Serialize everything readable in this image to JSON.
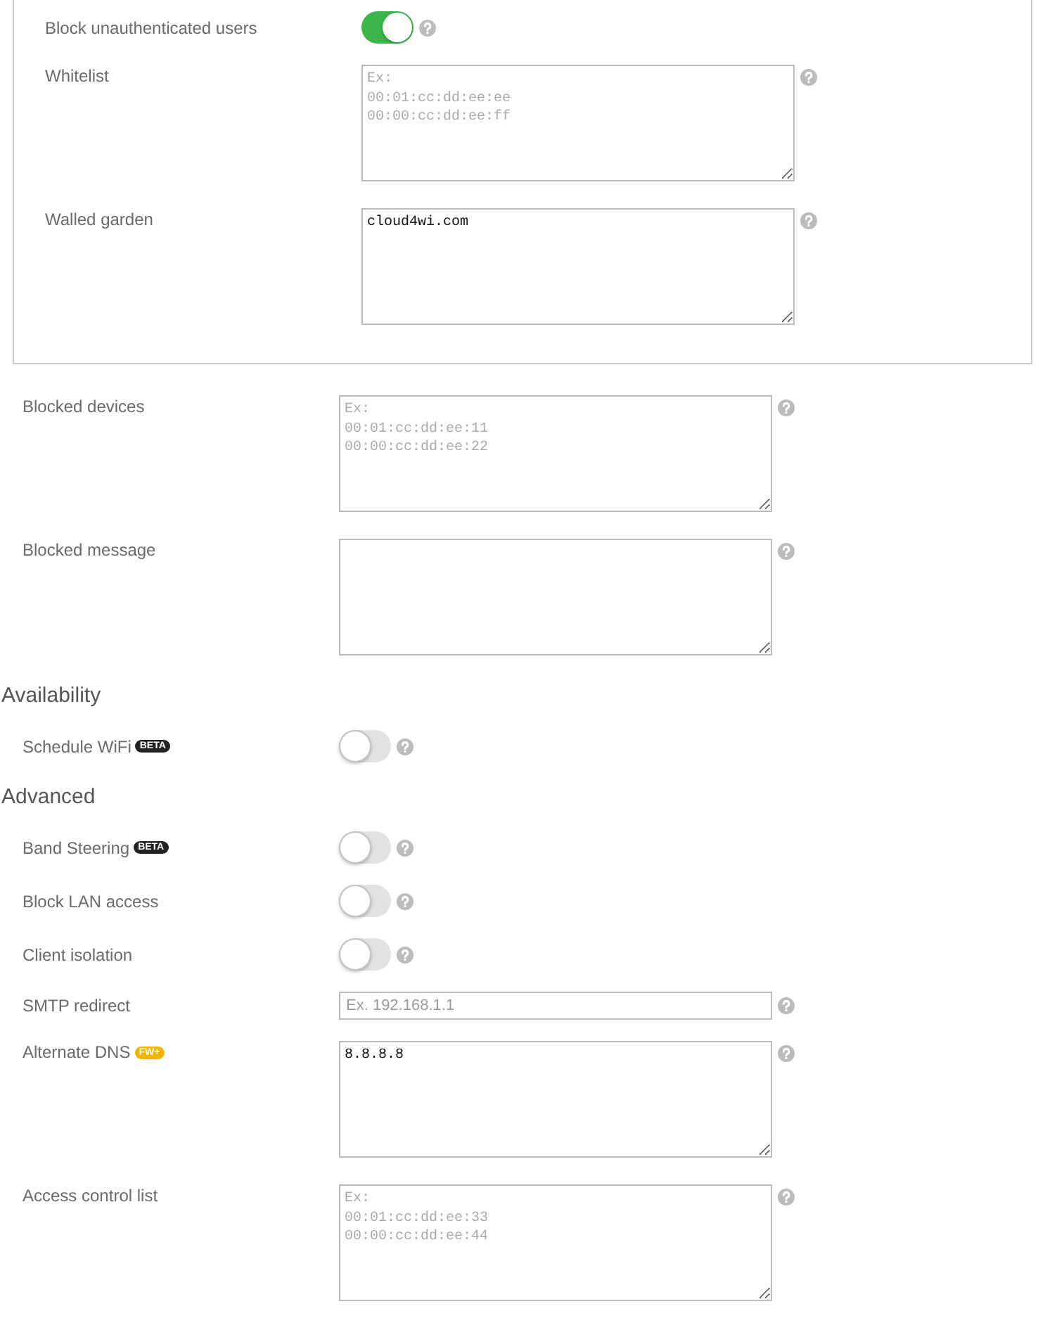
{
  "panel": {
    "rows": [
      {
        "kind": "toggle",
        "label": "Block unauthenticated users",
        "on": true
      },
      {
        "kind": "textarea",
        "label": "Whitelist",
        "placeholder": "Ex:\n00:01:cc:dd:ee:ee\n00:00:cc:dd:ee:ff"
      },
      {
        "kind": "textarea",
        "label": "Walled garden",
        "value": "cloud4wi.com"
      }
    ]
  },
  "rows": [
    {
      "kind": "textarea",
      "label": "Blocked devices",
      "placeholder": "Ex:\n00:01:cc:dd:ee:11\n00:00:cc:dd:ee:22"
    },
    {
      "kind": "textarea",
      "label": "Blocked message"
    }
  ],
  "sections": [
    {
      "title": "Availability",
      "rows": [
        {
          "kind": "toggle",
          "label": "Schedule WiFi",
          "badge": {
            "text": "BETA",
            "kind": "beta"
          },
          "on": false
        }
      ]
    },
    {
      "title": "Advanced",
      "rows": [
        {
          "kind": "toggle",
          "label": "Band Steering",
          "badge": {
            "text": "BETA",
            "kind": "beta"
          },
          "on": false
        },
        {
          "kind": "toggle",
          "label": "Block LAN access",
          "on": false
        },
        {
          "kind": "toggle",
          "label": "Client isolation",
          "on": false
        },
        {
          "kind": "input",
          "label": "SMTP redirect",
          "placeholder": "Ex. 192.168.1.1"
        },
        {
          "kind": "textarea",
          "label": "Alternate DNS",
          "badge": {
            "text": "FW+",
            "kind": "fw"
          },
          "value": "8.8.8.8"
        },
        {
          "kind": "textarea",
          "label": "Access control list",
          "placeholder": "Ex:\n00:01:cc:dd:ee:33\n00:00:cc:dd:ee:44"
        }
      ]
    }
  ]
}
